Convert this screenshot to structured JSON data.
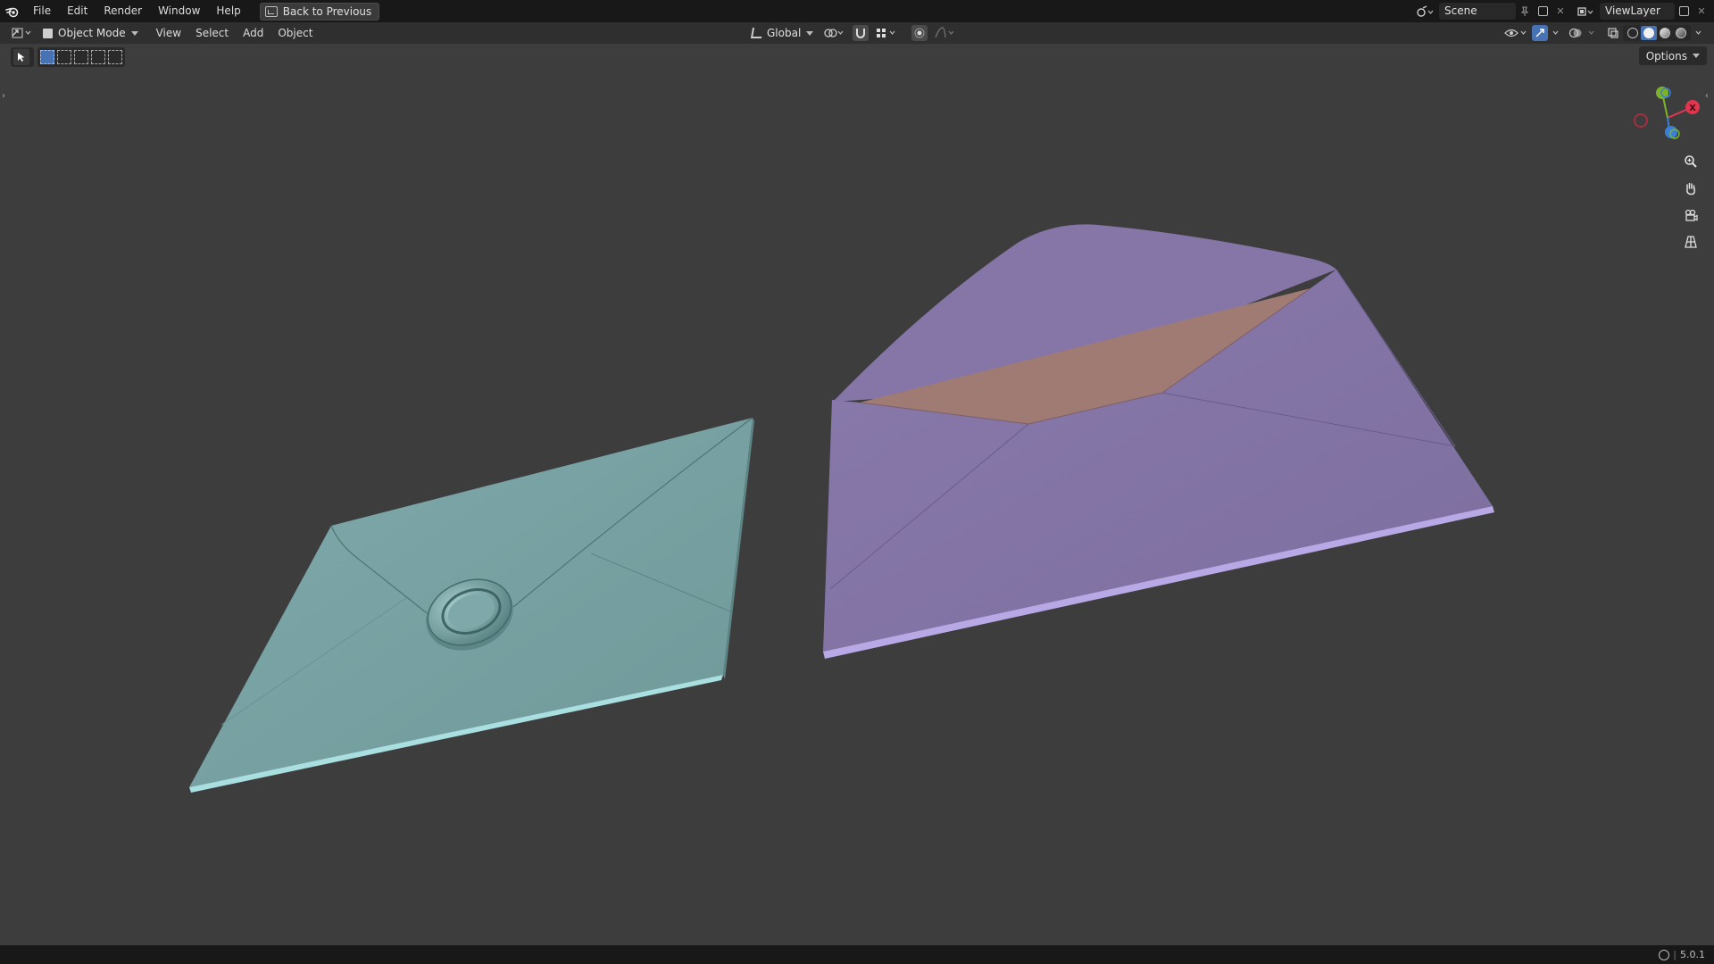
{
  "menu": {
    "items": [
      "File",
      "Edit",
      "Render",
      "Window",
      "Help"
    ],
    "back_button": "Back to Previous"
  },
  "topright": {
    "scene_name": "Scene",
    "view_layer": "ViewLayer"
  },
  "header": {
    "mode": "Object Mode",
    "menus": [
      "View",
      "Select",
      "Add",
      "Object"
    ],
    "transform_orientation": "Global"
  },
  "toolbar": {
    "options_label": "Options"
  },
  "gizmo": {
    "x_label": "X",
    "colors": {
      "x": "#e0364f",
      "y": "#7cb32a",
      "z": "#3b7fd6",
      "x_neg": "#a33040"
    }
  },
  "scene": {
    "objects": [
      {
        "name": "closed-envelope",
        "color": "#79a2a3",
        "seal": "wax-seal"
      },
      {
        "name": "open-envelope",
        "color": "#8576a6",
        "inner_color": "#a07b74"
      }
    ],
    "background": "#3d3d3d"
  },
  "status": {
    "version": "5.0.1"
  }
}
